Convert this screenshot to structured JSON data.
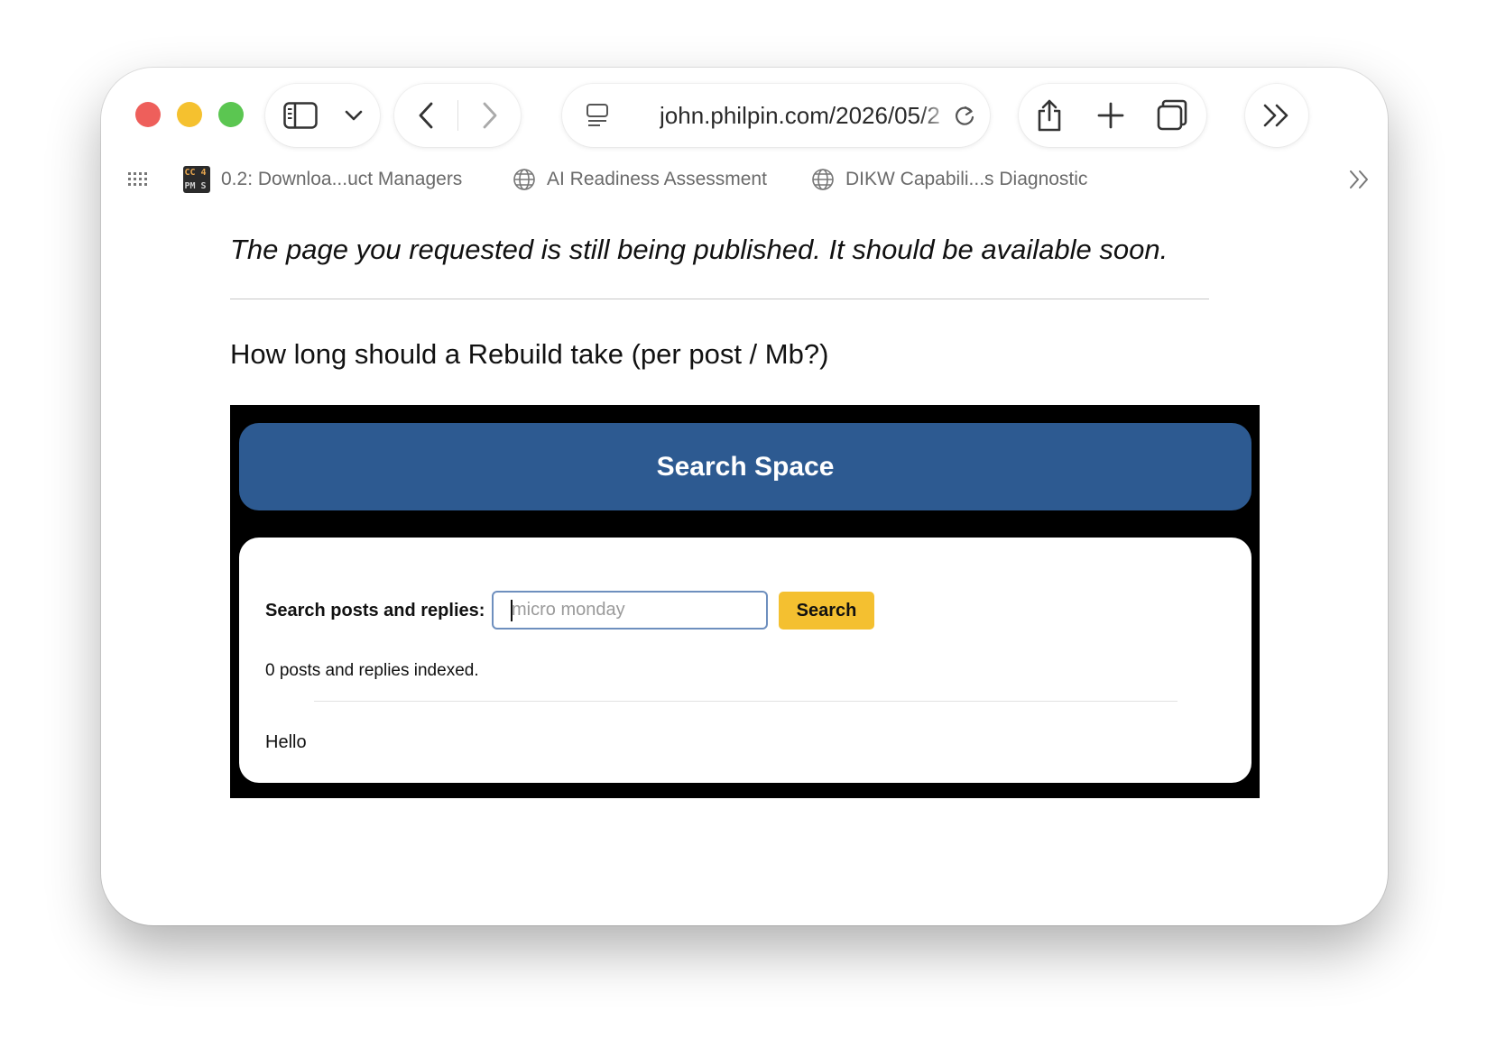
{
  "browser": {
    "url": "john.philpin.com/2026/05/2",
    "toolbar_icons": [
      "sidebar-icon",
      "chevron-down-icon",
      "back-icon",
      "forward-icon",
      "reader-icon",
      "reload-icon",
      "share-icon",
      "new-tab-icon",
      "tab-overview-icon",
      "more-icon"
    ]
  },
  "bookmarks": [
    {
      "label": "0.2: Downloa...uct Managers",
      "icon": "ccpms-favicon",
      "favicon_text": [
        "CC",
        "4",
        "PM",
        "S"
      ]
    },
    {
      "label": "AI Readiness Assessment",
      "icon": "globe-icon"
    },
    {
      "label": "DIKW Capabili...s Diagnostic",
      "icon": "globe-icon"
    }
  ],
  "page": {
    "notice": "The page you requested is still being published. It should be available soon.",
    "question": "How long should a Rebuild take (per post / Mb?)"
  },
  "embed": {
    "banner_title": "Search Space",
    "search_label": "Search posts and replies:",
    "search_placeholder": "micro monday",
    "search_value": "",
    "search_button": "Search",
    "indexed_text": "0 posts and replies indexed.",
    "greeting": "Hello",
    "colors": {
      "banner": "#2d5a91",
      "button": "#f4c030",
      "background": "#000000"
    }
  }
}
